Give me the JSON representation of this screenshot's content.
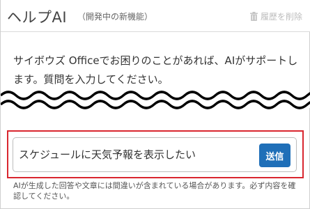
{
  "header": {
    "title": "ヘルプAI",
    "subtitle": "（開発中の新機能）",
    "clear_history_label": "履歴を削除"
  },
  "intro": {
    "text": "サイボウズ Officeでお困りのことがあれば、AIがサポートします。質問を入力してください。"
  },
  "input": {
    "value": "スケジュールに天気予報を表示したい",
    "send_label": "送信"
  },
  "note": {
    "text": "AIが生成した回答や文章には間違いが含まれている場合があります。必ず内容を確認してください。"
  },
  "colors": {
    "highlight_border": "#d9262f",
    "send_button": "#1f6fb8"
  },
  "icons": {
    "clear_history": "trash-icon"
  }
}
